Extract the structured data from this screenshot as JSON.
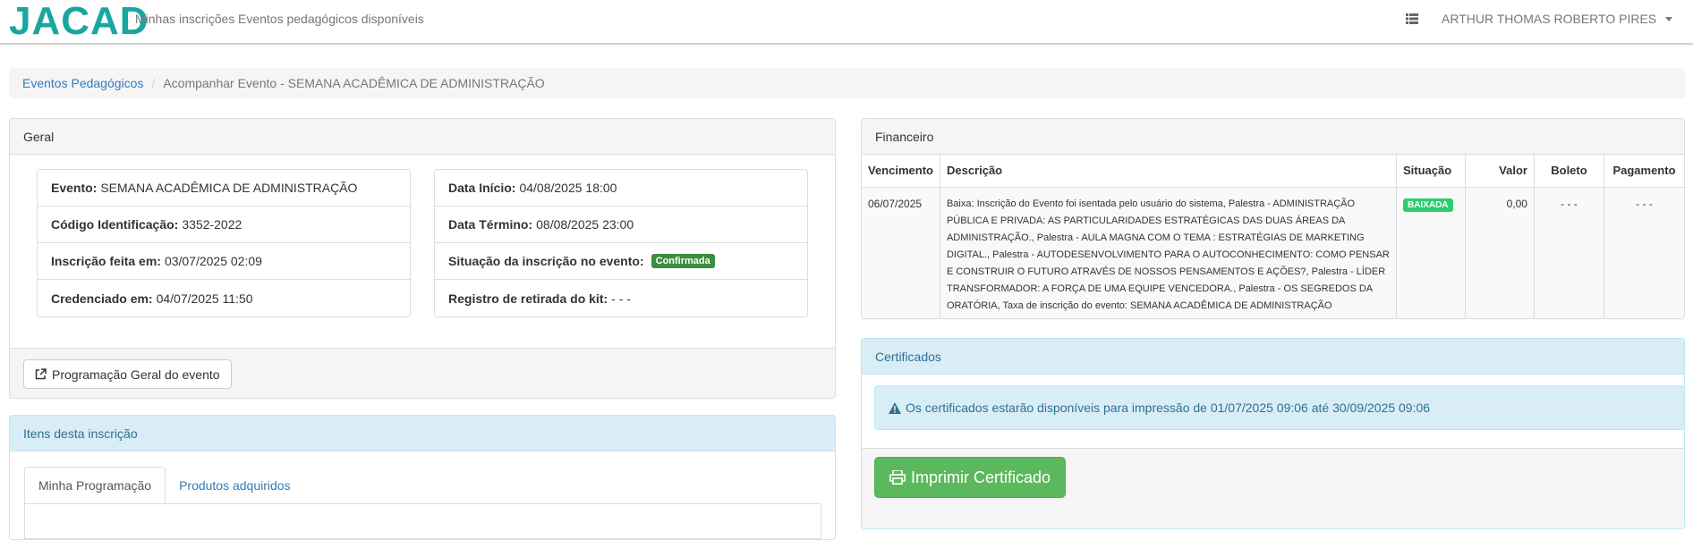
{
  "navbar": {
    "brand": "JACAD",
    "links": [
      "Minhas inscrições",
      "Eventos pedagógicos disponíveis"
    ],
    "user_name": "ARTHUR THOMAS ROBERTO PIRES",
    "brand_color": "#1aa6a0"
  },
  "breadcrumb": {
    "home": "Eventos Pedagógicos",
    "separator": "/",
    "current": "Acompanhar Evento - SEMANA ACADÊMICA DE ADMINISTRAÇÃO"
  },
  "geral": {
    "title": "Geral",
    "left": [
      {
        "label": "Evento:",
        "value": "SEMANA ACADÊMICA DE ADMINISTRAÇÃO"
      },
      {
        "label": "Código Identificação:",
        "value": "3352-2022"
      },
      {
        "label": "Inscrição feita em:",
        "value": "03/07/2025 02:09"
      },
      {
        "label": "Credenciado em:",
        "value": "04/07/2025 11:50"
      }
    ],
    "right": [
      {
        "label": "Data Início:",
        "value": "04/08/2025 18:00"
      },
      {
        "label": "Data Término:",
        "value": "08/08/2025 23:00"
      },
      {
        "label": "Situação da inscrição no evento:",
        "badge": "Confirmada"
      },
      {
        "label": "Registro de retirada do kit:",
        "value": "- - -"
      }
    ],
    "program_button": "Programação Geral do evento"
  },
  "itens": {
    "title": "Itens desta inscrição",
    "tabs": [
      "Minha Programação",
      "Produtos adquiridos"
    ]
  },
  "financeiro": {
    "title": "Financeiro",
    "columns": [
      "Vencimento",
      "Descrição",
      "Situação",
      "Valor",
      "Boleto",
      "Pagamento"
    ],
    "rows": [
      {
        "vencimento": "06/07/2025",
        "descricao": "Baixa: Inscrição do Evento foi isentada pelo usuário do sistema, Palestra - ADMINISTRAÇÃO PÚBLICA E PRIVADA: AS PARTICULARIDADES ESTRATÉGICAS DAS DUAS ÁREAS DA ADMINISTRAÇÃO., Palestra - AULA MAGNA COM O TEMA : ESTRATÉGIAS DE MARKETING DIGITAL., Palestra - AUTODESENVOLVIMENTO PARA O AUTOCONHECIMENTO: COMO PENSAR E CONSTRUIR O FUTURO ATRAVÉS DE NOSSOS PENSAMENTOS E AÇÕES?, Palestra - LÍDER TRANSFORMADOR: A FORÇA DE UMA EQUIPE VENCEDORA., Palestra - OS SEGREDOS DA ORATÓRIA, Taxa de inscrição do evento: SEMANA ACADÊMICA DE ADMINISTRAÇÃO",
        "situacao": "BAIXADA",
        "valor": "0,00",
        "boleto": "- - -",
        "pagamento": "- - -"
      }
    ]
  },
  "certificados": {
    "title": "Certificados",
    "alert": "Os certificados estarão disponíveis para impressão de 01/07/2025 09:06 até 30/09/2025 09:06",
    "print_button": "Imprimir Certificado"
  }
}
